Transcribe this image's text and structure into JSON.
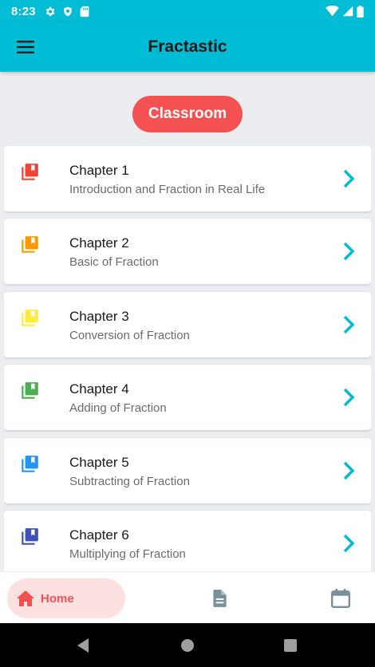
{
  "status_bar": {
    "time": "8:23"
  },
  "app_bar": {
    "title": "Fractastic"
  },
  "classroom": {
    "label": "Classroom"
  },
  "chapters": [
    {
      "title": "Chapter 1",
      "subtitle": "Introduction and Fraction in Real Life",
      "icon": "book-icon",
      "color": "#f44336"
    },
    {
      "title": "Chapter 2",
      "subtitle": "Basic of Fraction",
      "icon": "book-icon",
      "color": "#ff9800"
    },
    {
      "title": "Chapter 3",
      "subtitle": "Conversion of Fraction",
      "icon": "book-icon",
      "color": "#ffeb3b"
    },
    {
      "title": "Chapter 4",
      "subtitle": "Adding of Fraction",
      "icon": "book-icon",
      "color": "#4caf50"
    },
    {
      "title": "Chapter 5",
      "subtitle": "Subtracting of Fraction",
      "icon": "book-icon",
      "color": "#2196f3"
    },
    {
      "title": "Chapter 6",
      "subtitle": "Multiplying of Fraction",
      "icon": "book-icon",
      "color": "#3f51b5"
    }
  ],
  "bottom_nav": {
    "home_label": "Home",
    "home_icon": "home-icon",
    "docs_icon": "document-icon",
    "calendar_icon": "calendar-icon"
  },
  "colors": {
    "primary": "#00bcd4",
    "accent": "#f45153",
    "chevron": "#00bcd4",
    "nav_icon": "#78909c"
  }
}
